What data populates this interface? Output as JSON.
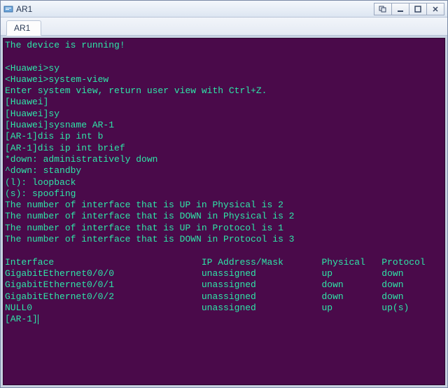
{
  "window": {
    "title": "AR1"
  },
  "tabs": [
    {
      "label": "AR1"
    }
  ],
  "terminal": {
    "banner": "The device is running!",
    "lines": [
      "<Huawei>sy",
      "<Huawei>system-view",
      "Enter system view, return user view with Ctrl+Z.",
      "[Huawei]",
      "[Huawei]sy",
      "[Huawei]sysname AR-1",
      "[AR-1]dis ip int b",
      "[AR-1]dis ip int brief",
      "*down: administratively down",
      "^down: standby",
      "(l): loopback",
      "(s): spoofing",
      "The number of interface that is UP in Physical is 2",
      "The number of interface that is DOWN in Physical is 2",
      "The number of interface that is UP in Protocol is 1",
      "The number of interface that is DOWN in Protocol is 3"
    ],
    "table": {
      "headers": [
        "Interface",
        "IP Address/Mask",
        "Physical",
        "Protocol"
      ],
      "rows": [
        {
          "interface": "GigabitEthernet0/0/0",
          "ip": "unassigned",
          "physical": "up",
          "protocol": "down"
        },
        {
          "interface": "GigabitEthernet0/0/1",
          "ip": "unassigned",
          "physical": "down",
          "protocol": "down"
        },
        {
          "interface": "GigabitEthernet0/0/2",
          "ip": "unassigned",
          "physical": "down",
          "protocol": "down"
        },
        {
          "interface": "NULL0",
          "ip": "unassigned",
          "physical": "up",
          "protocol": "up(s)"
        }
      ]
    },
    "prompt": "[AR-1]"
  },
  "colors": {
    "terminal_bg": "#4a0a4a",
    "terminal_fg": "#2ee6a8"
  }
}
